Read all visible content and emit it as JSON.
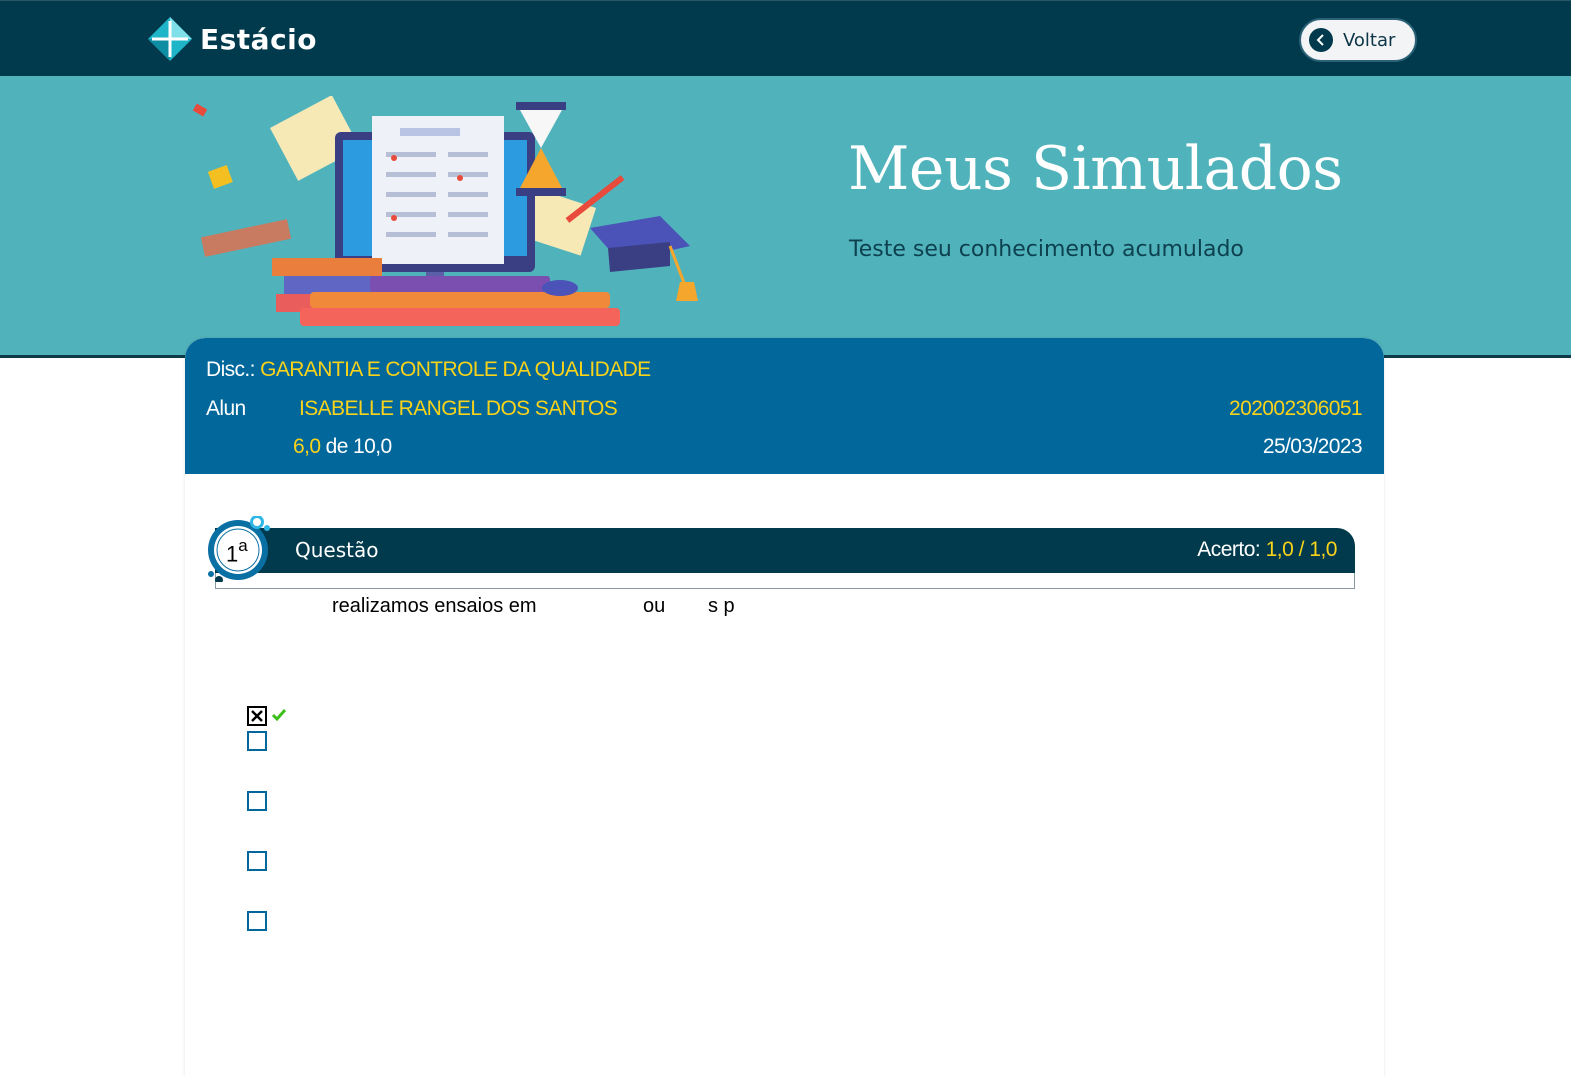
{
  "header": {
    "brand": "Estácio",
    "back_label": "Voltar"
  },
  "hero": {
    "title": "Meus Simulados",
    "subtitle": "Teste seu conhecimento acumulado"
  },
  "exam": {
    "disc_label": "Disc.:",
    "disc_value": "GARANTIA E CONTROLE DA QUALIDADE",
    "student_label": "Alun",
    "student_name": "ISABELLE RANGEL DOS SANTOS",
    "student_id": "202002306051",
    "score_value": "6,0",
    "score_of": "de 10,0",
    "date": "25/03/2023"
  },
  "question": {
    "number": "1",
    "ordinal": "a",
    "label": "Questão",
    "score_label": "Acerto:",
    "score_value": "1,0",
    "score_sep": "/",
    "score_max": "1,0",
    "text_fragments": [
      "realizamos ensaios em",
      "ou",
      "s p"
    ],
    "options": [
      {
        "checked": true,
        "correct": true
      },
      {
        "checked": false,
        "correct": false
      },
      {
        "checked": false,
        "correct": false
      },
      {
        "checked": false,
        "correct": false
      },
      {
        "checked": false,
        "correct": false
      }
    ]
  },
  "colors": {
    "nav_bg": "#013a4c",
    "hero_bg": "#50b3bb",
    "card_head_bg": "#02679b",
    "highlight": "#f9d31a",
    "correct_check": "#3bbf1a"
  }
}
